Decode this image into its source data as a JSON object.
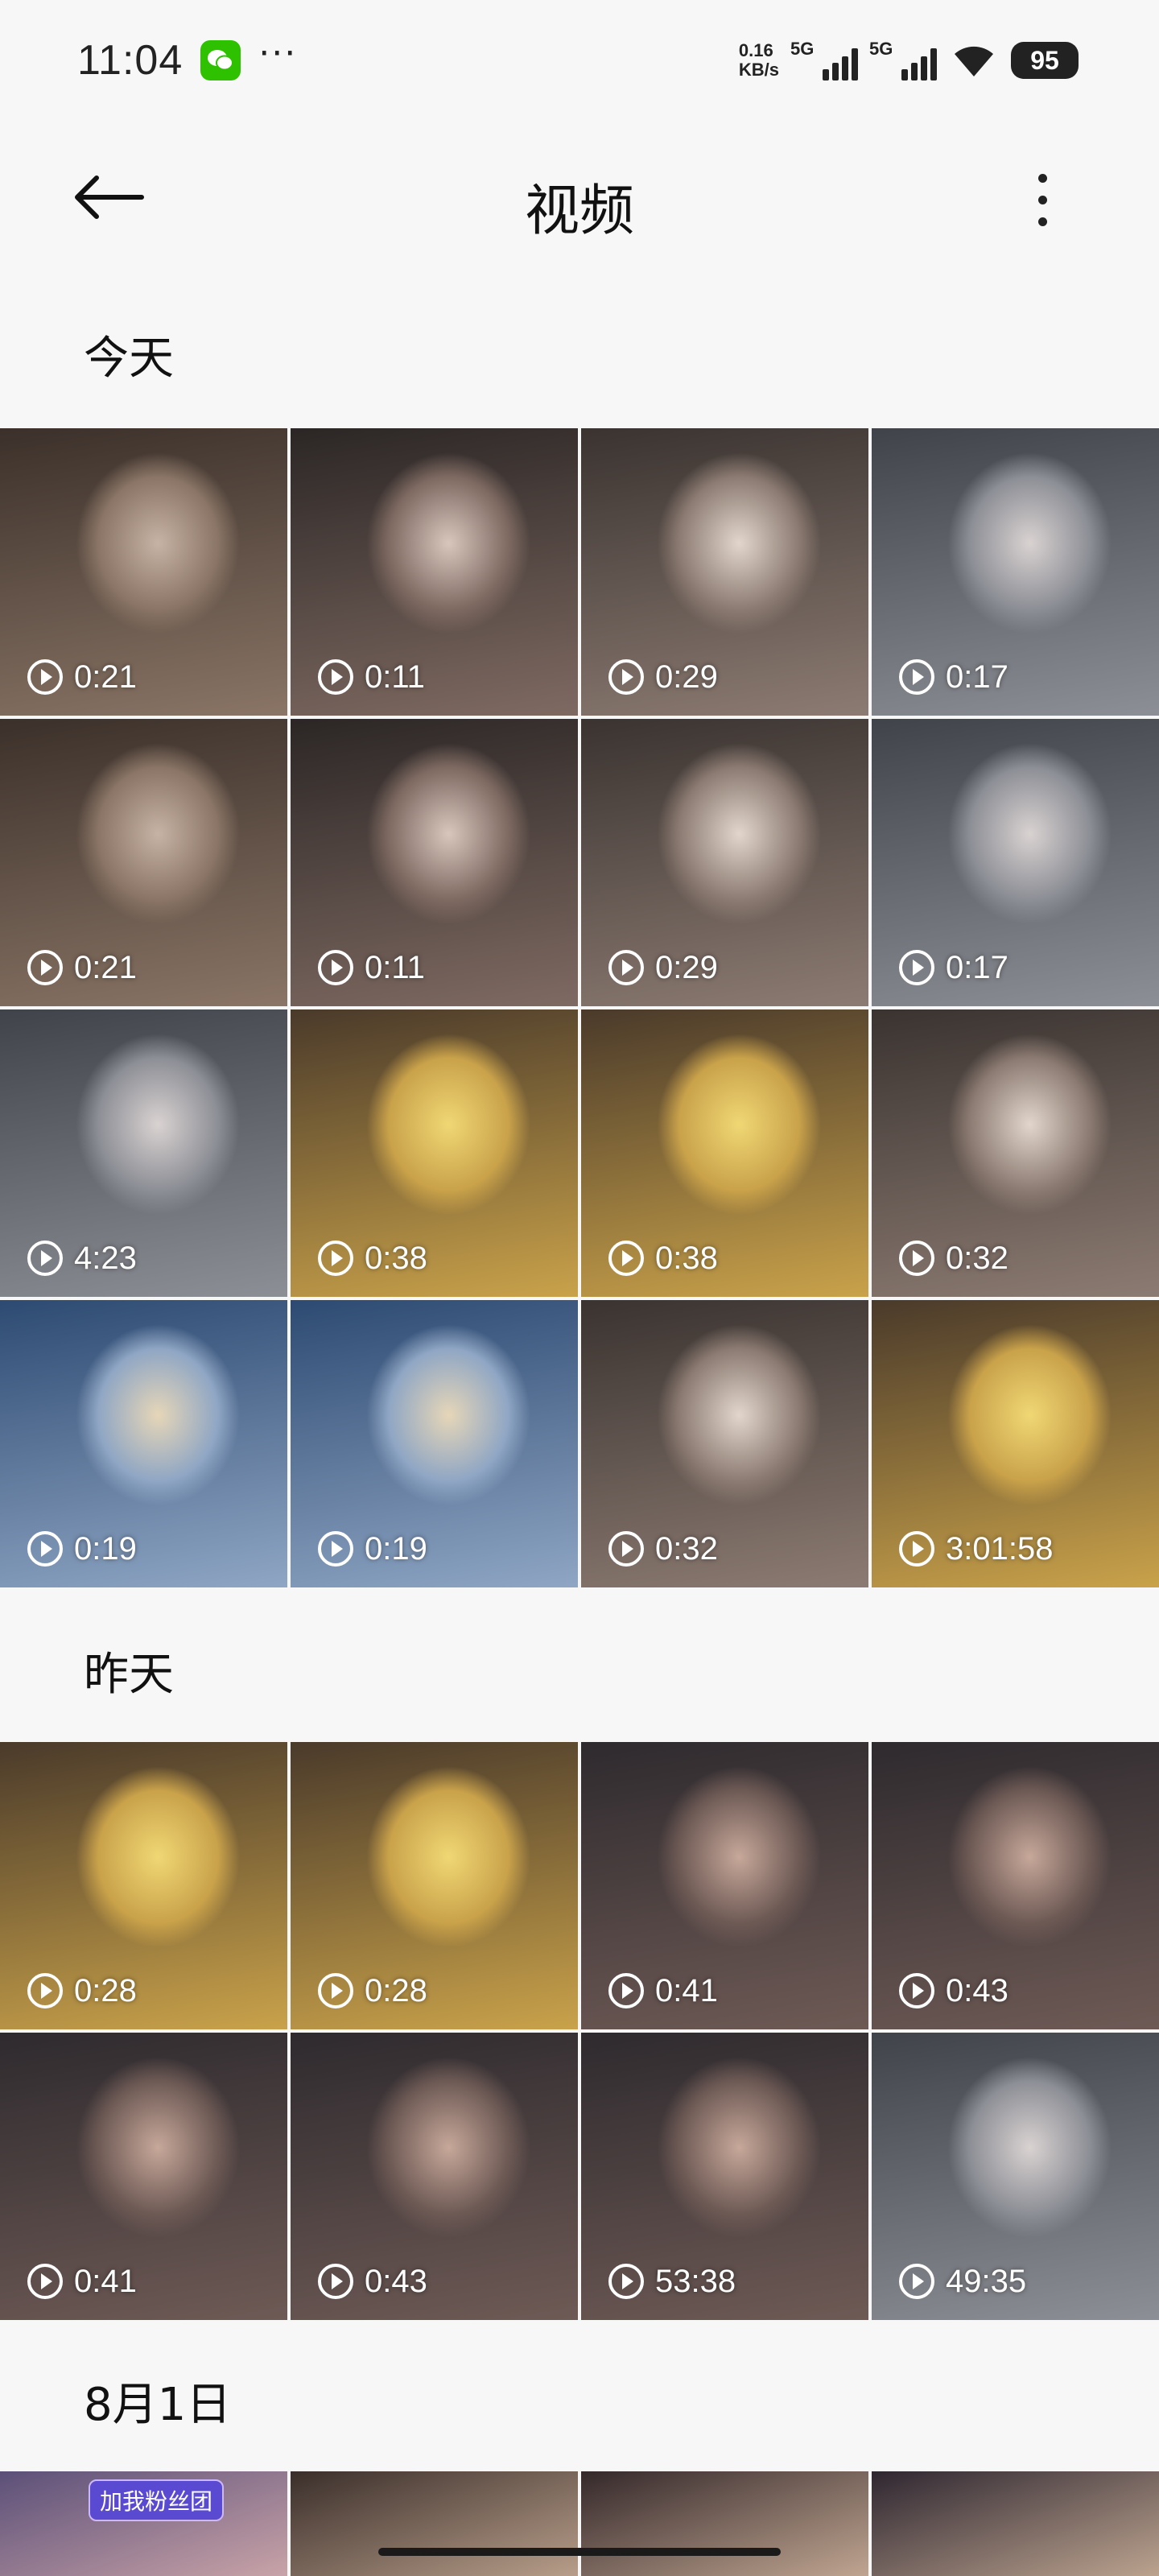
{
  "status": {
    "time": "11:04",
    "net_speed_value": "0.16",
    "net_speed_unit": "KB/s",
    "signal1_label": "5G",
    "signal2_label": "5G",
    "battery": "95",
    "more_dots": "···"
  },
  "header": {
    "title": "视频"
  },
  "sections": [
    {
      "title": "今天",
      "durations": [
        "0:21",
        "0:11",
        "0:29",
        "0:17",
        "0:21",
        "0:11",
        "0:29",
        "0:17",
        "4:23",
        "0:38",
        "0:38",
        "0:32",
        "0:19",
        "0:19",
        "0:32",
        "3:01:58"
      ]
    },
    {
      "title": "昨天",
      "durations": [
        "0:28",
        "0:28",
        "0:41",
        "0:43",
        "0:41",
        "0:43",
        "53:38",
        "49:35"
      ]
    },
    {
      "title": "8月1日",
      "durations": []
    }
  ],
  "peek_banner_text": "加我粉丝团",
  "colors": {
    "background": "#f7f7f7",
    "wechat_green": "#2dc100",
    "text_dark": "#111111"
  }
}
